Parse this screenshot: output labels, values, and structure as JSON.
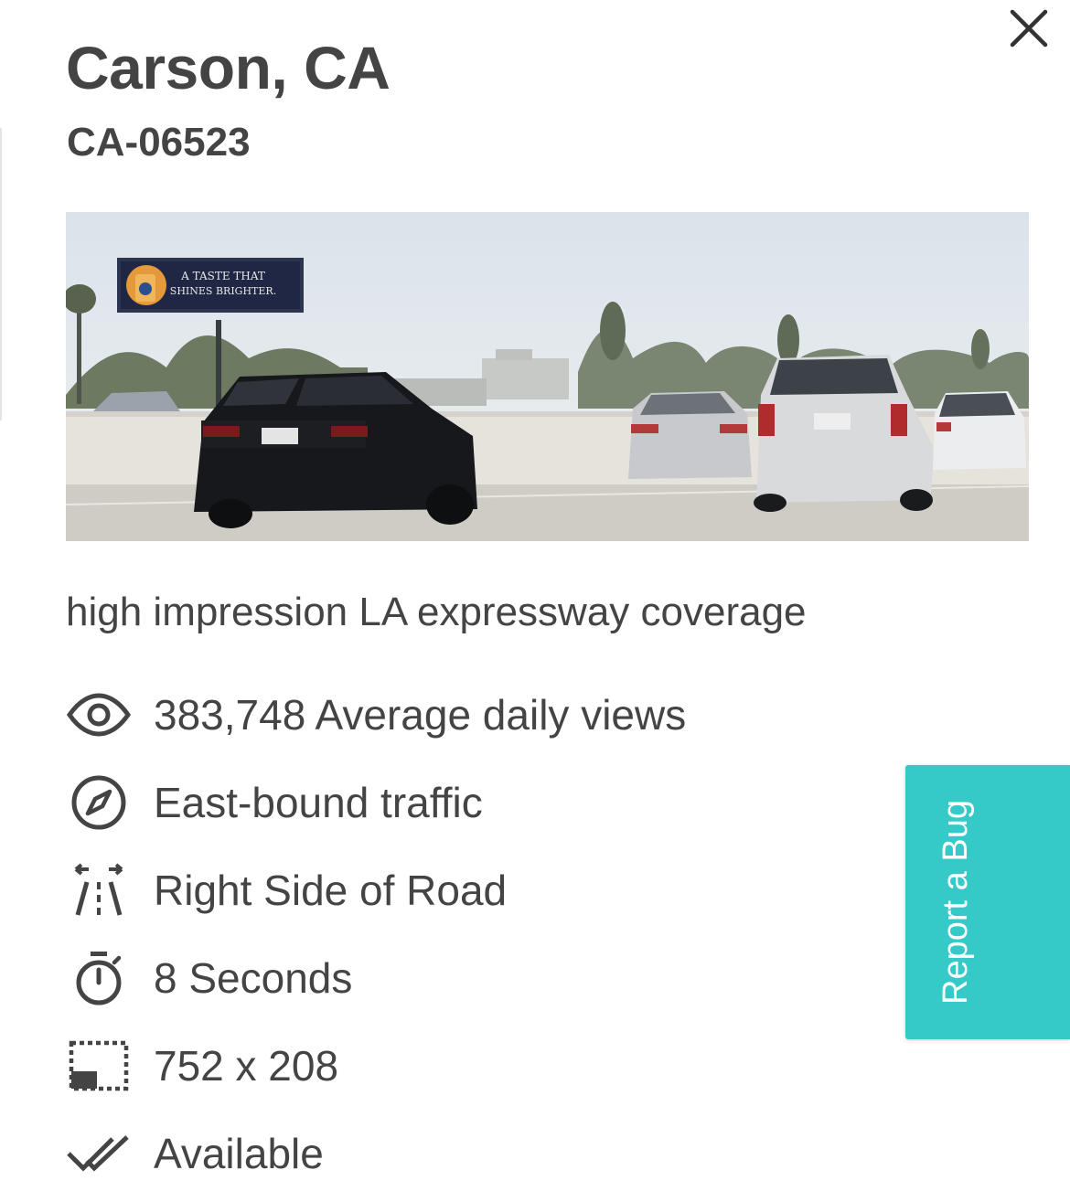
{
  "listing": {
    "title": "Carson, CA",
    "site_id": "CA-06523",
    "description": "high impression LA expressway coverage",
    "photo": {
      "billboard_text": "A TASTE THAT SHINES BRIGHTER."
    },
    "details": [
      {
        "icon": "eye-icon",
        "text": "383,748 Average daily views"
      },
      {
        "icon": "compass-icon",
        "text": "East-bound traffic"
      },
      {
        "icon": "road-side-icon",
        "text": "Right Side of Road"
      },
      {
        "icon": "stopwatch-icon",
        "text": "8 Seconds"
      },
      {
        "icon": "dimensions-icon",
        "text": "752 x 208"
      },
      {
        "icon": "double-check-icon",
        "text": "Available"
      }
    ]
  },
  "controls": {
    "close_icon": "close-icon",
    "report_bug_label": "Report a Bug"
  },
  "colors": {
    "text": "#444444",
    "accent": "#35c9c8",
    "accent_text": "#ffffff"
  }
}
